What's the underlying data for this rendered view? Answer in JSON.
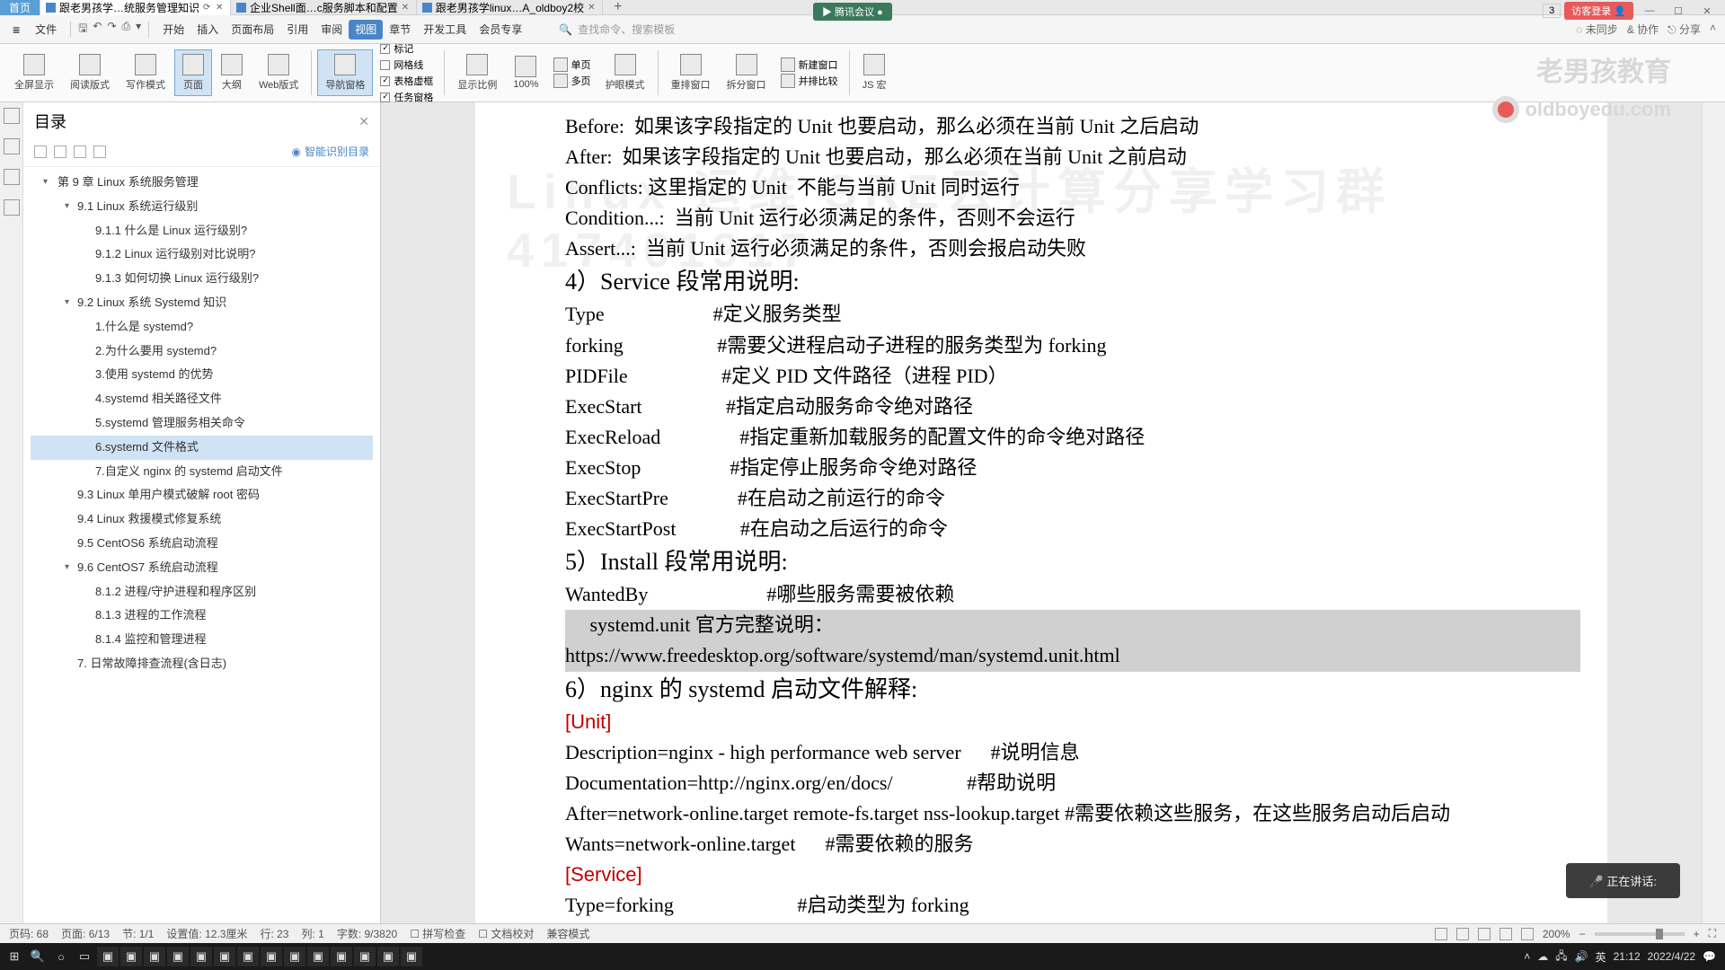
{
  "tabs": {
    "home": "首页",
    "items": [
      {
        "label": "跟老男孩学…统服务管理知识",
        "active": true
      },
      {
        "label": "企业Shell面…c服务脚本和配置"
      },
      {
        "label": "跟老男孩学linux…A_oldboy2校"
      }
    ]
  },
  "floating_badge": "▶ 腾讯会议 ●",
  "title_right": {
    "count": "3",
    "login": "访客登录 👤"
  },
  "win": {
    "min": "—",
    "max": "☐",
    "close": "✕"
  },
  "menu": {
    "file": "文件",
    "items": [
      "开始",
      "插入",
      "页面布局",
      "引用",
      "审阅",
      "视图",
      "章节",
      "开发工具",
      "会员专享"
    ],
    "active_index": 5,
    "search_label": "查找命令、搜索模板",
    "right": [
      "◌ 未同步",
      "& 协作",
      "⎋ 分享"
    ]
  },
  "toolbar": {
    "items": [
      "全屏显示",
      "阅读版式",
      "写作模式",
      "页面",
      "大纲",
      "Web版式"
    ],
    "nav": "导航窗格",
    "checks": [
      {
        "label": "标记",
        "checked": true
      },
      {
        "label": "网格线",
        "checked": false
      },
      {
        "label": "表格虚框",
        "checked": true
      },
      {
        "label": "任务窗格",
        "checked": true
      }
    ],
    "zoom_btns": [
      "显示比例",
      "100%"
    ],
    "eye_btn": "护眼模式",
    "page_tools": [
      "单页",
      "多页"
    ],
    "arrange": "重排窗口",
    "split": "拆分窗口",
    "new_win": "新建窗口",
    "side": "并排比较",
    "js": "JS 宏"
  },
  "outline": {
    "title": "目录",
    "smart": "智能识别目录",
    "tree": [
      {
        "level": "l1",
        "expand": true,
        "text": "第 9 章   Linux 系统服务管理"
      },
      {
        "level": "l2",
        "expand": true,
        "text": "9.1 Linux 系统运行级别"
      },
      {
        "level": "l3",
        "text": "9.1.1 什么是 Linux 运行级别?"
      },
      {
        "level": "l3",
        "text": "9.1.2 Linux 运行级别对比说明?"
      },
      {
        "level": "l3",
        "text": "9.1.3 如何切换 Linux 运行级别?"
      },
      {
        "level": "l2",
        "expand": true,
        "text": "9.2 Linux 系统 Systemd 知识"
      },
      {
        "level": "l3",
        "text": "1.什么是 systemd?"
      },
      {
        "level": "l3",
        "text": "2.为什么要用 systemd?"
      },
      {
        "level": "l3",
        "text": "3.使用 systemd 的优势"
      },
      {
        "level": "l3",
        "text": "4.systemd 相关路径文件"
      },
      {
        "level": "l3",
        "text": "5.systemd 管理服务相关命令"
      },
      {
        "level": "l3",
        "text": "6.systemd 文件格式",
        "selected": true
      },
      {
        "level": "l3",
        "text": "7.自定义 nginx 的 systemd 启动文件"
      },
      {
        "level": "l2",
        "text": "9.3 Linux 单用户模式破解 root 密码"
      },
      {
        "level": "l2",
        "text": "9.4 Linux 救援模式修复系统"
      },
      {
        "level": "l2",
        "text": "9.5 CentOS6 系统启动流程"
      },
      {
        "level": "l2",
        "expand": true,
        "text": "9.6 CentOS7 系统启动流程"
      },
      {
        "level": "l3",
        "text": "8.1.2 进程/守护进程和程序区别"
      },
      {
        "level": "l3",
        "text": "8.1.3 进程的工作流程"
      },
      {
        "level": "l3",
        "text": "8.1.4 监控和管理进程"
      },
      {
        "level": "l2",
        "text": "7. 日常故障排查流程(含日志)"
      }
    ]
  },
  "doc": {
    "lines": [
      "Before:  如果该字段指定的 Unit 也要启动，那么必须在当前 Unit 之后启动",
      "After:  如果该字段指定的 Unit 也要启动，那么必须在当前 Unit 之前启动",
      "Conflicts: 这里指定的 Unit  不能与当前 Unit 同时运行",
      "Condition...:  当前 Unit 运行必须满足的条件，否则不会运行",
      "Assert...:  当前 Unit 运行必须满足的条件，否则会报启动失败",
      "4）Service 段常用说明:",
      "Type                      #定义服务类型",
      "forking                   #需要父进程启动子进程的服务类型为 forking",
      "PIDFile                   #定义 PID 文件路径（进程 PID）",
      "ExecStart                 #指定启动服务命令绝对路径",
      "ExecReload                #指定重新加载服务的配置文件的命令绝对路径",
      "ExecStop                  #指定停止服务命令绝对路径",
      "ExecStartPre              #在启动之前运行的命令",
      "ExecStartPost             #在启动之后运行的命令",
      "5）Install 段常用说明:",
      "WantedBy                        #哪些服务需要被依赖",
      "     systemd.unit 官方完整说明：",
      "https://www.freedesktop.org/software/systemd/man/systemd.unit.html",
      "6）nginx 的 systemd 启动文件解释:",
      "[Unit]",
      "Description=nginx - high performance web server      #说明信息",
      "Documentation=http://nginx.org/en/docs/               #帮助说明",
      "After=network-online.target remote-fs.target nss-lookup.target #需要依赖这些服务，在这些服务启动后启动",
      "Wants=network-online.target      #需要依赖的服务",
      "",
      "[Service]",
      "Type=forking                         #启动类型为 forking"
    ],
    "header_idx": [
      5,
      14,
      18
    ],
    "hl_idx": [
      16,
      17
    ],
    "red_idx": [
      19,
      25
    ]
  },
  "watermark": {
    "line1": "老男孩教育",
    "line2": "oldboyedu.com"
  },
  "bg_watermark": "Linux 运维 SRE云计算分享学习群 417401917",
  "voice": "🎤  正在讲话:",
  "status": {
    "items": [
      "页码: 68",
      "页面: 6/13",
      "节: 1/1",
      "设置值: 12.3厘米",
      "行: 23",
      "列: 1",
      "字数: 9/3820",
      "☐ 拼写检查",
      "☐ 文档校对",
      "兼容模式"
    ],
    "zoom": "200%"
  },
  "task": {
    "time": "21:12",
    "date": "2022/4/22"
  }
}
